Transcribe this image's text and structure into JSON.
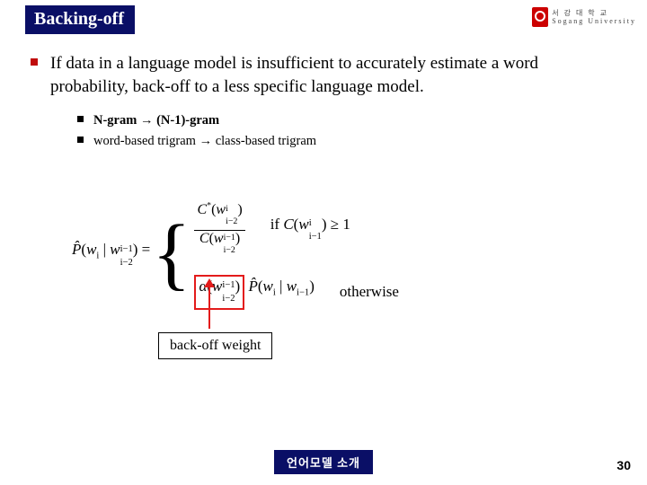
{
  "title": "Backing-off",
  "logo": {
    "line1": "서 강 대 학 교",
    "line2": "Sogang University"
  },
  "bullet_main": "If data in a language model is insufficient to accurately estimate a word probability, back-off to a less specific language model.",
  "sub_bullets": {
    "b1_left": "N-gram",
    "b1_arrow": "→",
    "b1_right": "(N-1)-gram",
    "b2": "word-based trigram → class-based trigram"
  },
  "equation": {
    "lhs_hat": "P̂",
    "lhs_open": "(",
    "lhs_w": "w",
    "lhs_i": "i",
    "lhs_bar": " | ",
    "lhs_w2": "w",
    "lhs_sup": "i−1",
    "lhs_sub": "i−2",
    "lhs_close": ") =",
    "case1_num_C": "C",
    "case1_num_star": "*",
    "case1_num_open": "(",
    "case1_num_w": "w",
    "case1_num_sup": "i",
    "case1_num_sub": "i−2",
    "case1_num_close": ")",
    "case1_den_C": "C",
    "case1_den_open": "(",
    "case1_den_w": "w",
    "case1_den_sup": "i−1",
    "case1_den_sub": "i−2",
    "case1_den_close": ")",
    "cond1_if": "if  ",
    "cond1_C": "C",
    "cond1_open": "(",
    "cond1_w": "w",
    "cond1_sup": "i",
    "cond1_sub": "i−1",
    "cond1_close": ") ≥ 1",
    "case2_alpha": "α",
    "case2_a_open": "(",
    "case2_a_w": "w",
    "case2_a_sup": "i−1",
    "case2_a_sub": "i−2",
    "case2_a_close": ")",
    "case2_P": "P̂",
    "case2_p_open": "(",
    "case2_p_w": "w",
    "case2_p_i": "i",
    "case2_p_bar": " | ",
    "case2_p_w2": "w",
    "case2_p_im1": "i−1",
    "case2_p_close": ")",
    "cond2": "otherwise"
  },
  "weight_label": "back-off weight",
  "footer": "언어모델 소개",
  "page": "30"
}
